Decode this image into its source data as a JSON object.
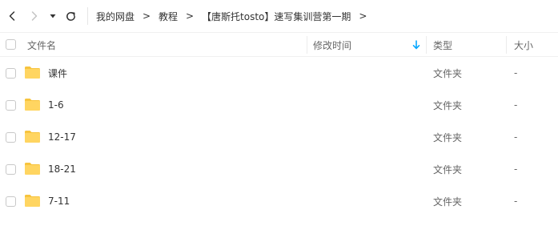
{
  "toolbar": {
    "back_icon": "chevron-left-icon",
    "forward_icon": "chevron-right-icon",
    "history_icon": "caret-down-icon",
    "refresh_icon": "refresh-icon"
  },
  "breadcrumb": {
    "items": [
      "我的网盘",
      "教程",
      "【唐斯托tosto】速写集训营第一期"
    ],
    "separator": ">"
  },
  "header": {
    "name": "文件名",
    "modified": "修改时间",
    "type": "类型",
    "size": "大小",
    "sort_icon": "arrow-down-icon",
    "sort_color": "#06a7ff"
  },
  "files": [
    {
      "name": "课件",
      "modified": "",
      "type": "文件夹",
      "size": "-",
      "icon": "folder-icon"
    },
    {
      "name": "1-6",
      "modified": "",
      "type": "文件夹",
      "size": "-",
      "icon": "folder-icon"
    },
    {
      "name": "12-17",
      "modified": "",
      "type": "文件夹",
      "size": "-",
      "icon": "folder-icon"
    },
    {
      "name": "18-21",
      "modified": "",
      "type": "文件夹",
      "size": "-",
      "icon": "folder-icon"
    },
    {
      "name": "7-11",
      "modified": "",
      "type": "文件夹",
      "size": "-",
      "icon": "folder-icon"
    }
  ],
  "colors": {
    "folder": "#ffd561",
    "folder_tab": "#f7c43e",
    "accent": "#06a7ff"
  }
}
